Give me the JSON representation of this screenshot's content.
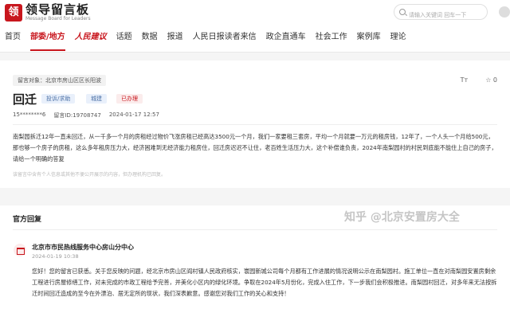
{
  "site": {
    "logo_mark": "领",
    "title": "领导留言板",
    "subtitle": "Message Board for Leaders"
  },
  "search": {
    "placeholder": "请输入关键词 回车一下"
  },
  "nav": {
    "items": [
      "首页",
      "部委/地方",
      "人民建议",
      "话题",
      "数据",
      "报道",
      "人民日报读者来信",
      "政企直通车",
      "社会工作",
      "案例库",
      "理论"
    ]
  },
  "message": {
    "target": "留言对象：北京市房山区区长阳波",
    "title": "回迁",
    "tags": [
      "投诉/求助",
      "城建",
      "已办理"
    ],
    "author": "15********6",
    "id": "留言ID:19708747",
    "date": "2024-01-17 12:57",
    "text_size_label": "Tт",
    "favorite_label": "☆ 0",
    "content": "南梨园拆迁12年一直未回迁，从一千多一个月的房租经过物价飞涨房租已经高达3500元一个月，我们一家要租三套房，平均一个月就要一万元的租房钱，12年了，一个人头一个月给500元，那也够一个房子的房租，这么多年租房压力大，经济困难到无经济能力租房住，回迁房迟迟不让住，老百姓生活压力大，这个补偿谁负责，2024年南梨园村的村民到底能不能住上自己的房子，请给一个明确的答复",
    "notice": "该留言中含有个人信息或其他不便公开展示的内容，但办理机构已回复。"
  },
  "reply": {
    "heading": "官方回复",
    "org": "北京市市民热线服务中心房山分中心",
    "time": "2024-01-19 10:38",
    "text": "您好！您的留言已获悉。关于您反映的问题，经北京市房山区阎村镇人民政府核实，寰园新城公司每个月都有工作进展的情况说明公示在南梨园村。施工单位一直在对南梨园安置房剩余工程进行房屋修缮工作，对未完成的市政工程给予完善，并美化小区内的绿化环境。争取在2024年5月份化，完成入住工作，下一步我们会积极推进。南梨园村回迁，对多年来无法按拆迁时间回迁造成的至今在外漂泊、居无定所的现状，我们深表歉意。感谢您对我们工作的关心和支持！"
  },
  "watermark": "知乎 @北京安置房大全"
}
